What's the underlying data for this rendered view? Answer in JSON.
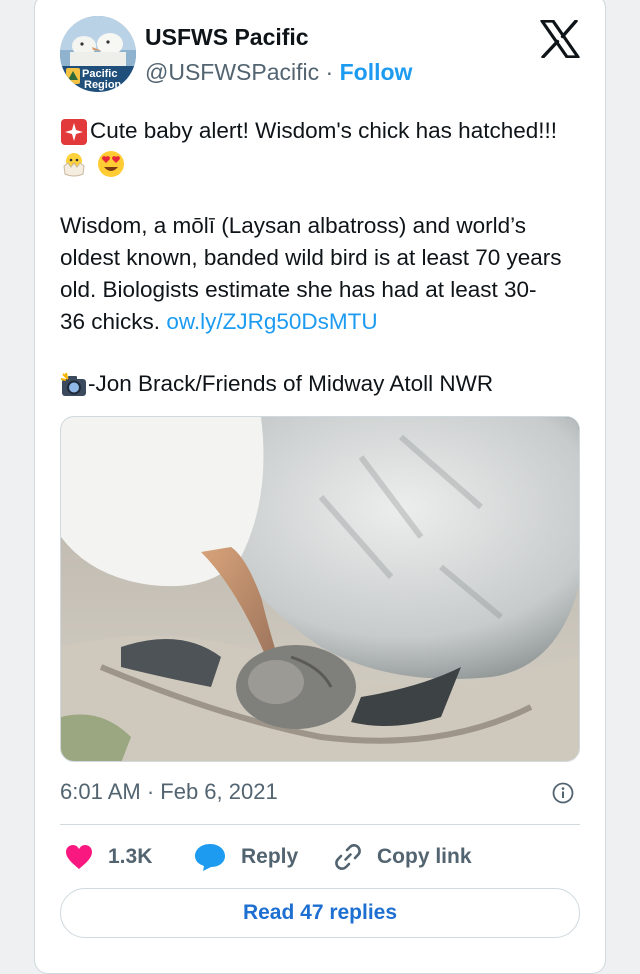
{
  "author": {
    "name": "USFWS Pacific",
    "handle": "@USFWSPacific",
    "separator": "·",
    "follow_label": "Follow",
    "avatar_badge_line1": "Pacific",
    "avatar_badge_line2": "Region"
  },
  "tweet": {
    "line1": "Cute baby alert! Wisdom's chick has hatched!!!",
    "para2_line1": "Wisdom, a mōlī (Laysan albatross) and world’s",
    "para2_line2": "oldest known, banded wild bird is at least 70 years",
    "para2_line3": "old. Biologists estimate she has had at least 30-",
    "para2_line4_text": "36 chicks.",
    "link": "ow.ly/ZJRg50DsMTU",
    "credit": "-Jon Brack/Friends of Midway Atoll NWR"
  },
  "icons": {
    "siren": "rotating-light-emoji",
    "chick": "hatching-chick-emoji",
    "heart_eyes": "heart-eyes-emoji",
    "camera": "camera-flash-emoji",
    "platform": "x-logo-icon"
  },
  "meta": {
    "timestamp": "6:01 AM · Feb 6, 2021"
  },
  "actions": {
    "like_count": "1.3K",
    "reply_label": "Reply",
    "copy_label": "Copy link",
    "read_replies_label": "Read 47 replies"
  },
  "colors": {
    "like": "#f91880",
    "reply": "#1d9bf0",
    "link": "#1d9bf0"
  }
}
